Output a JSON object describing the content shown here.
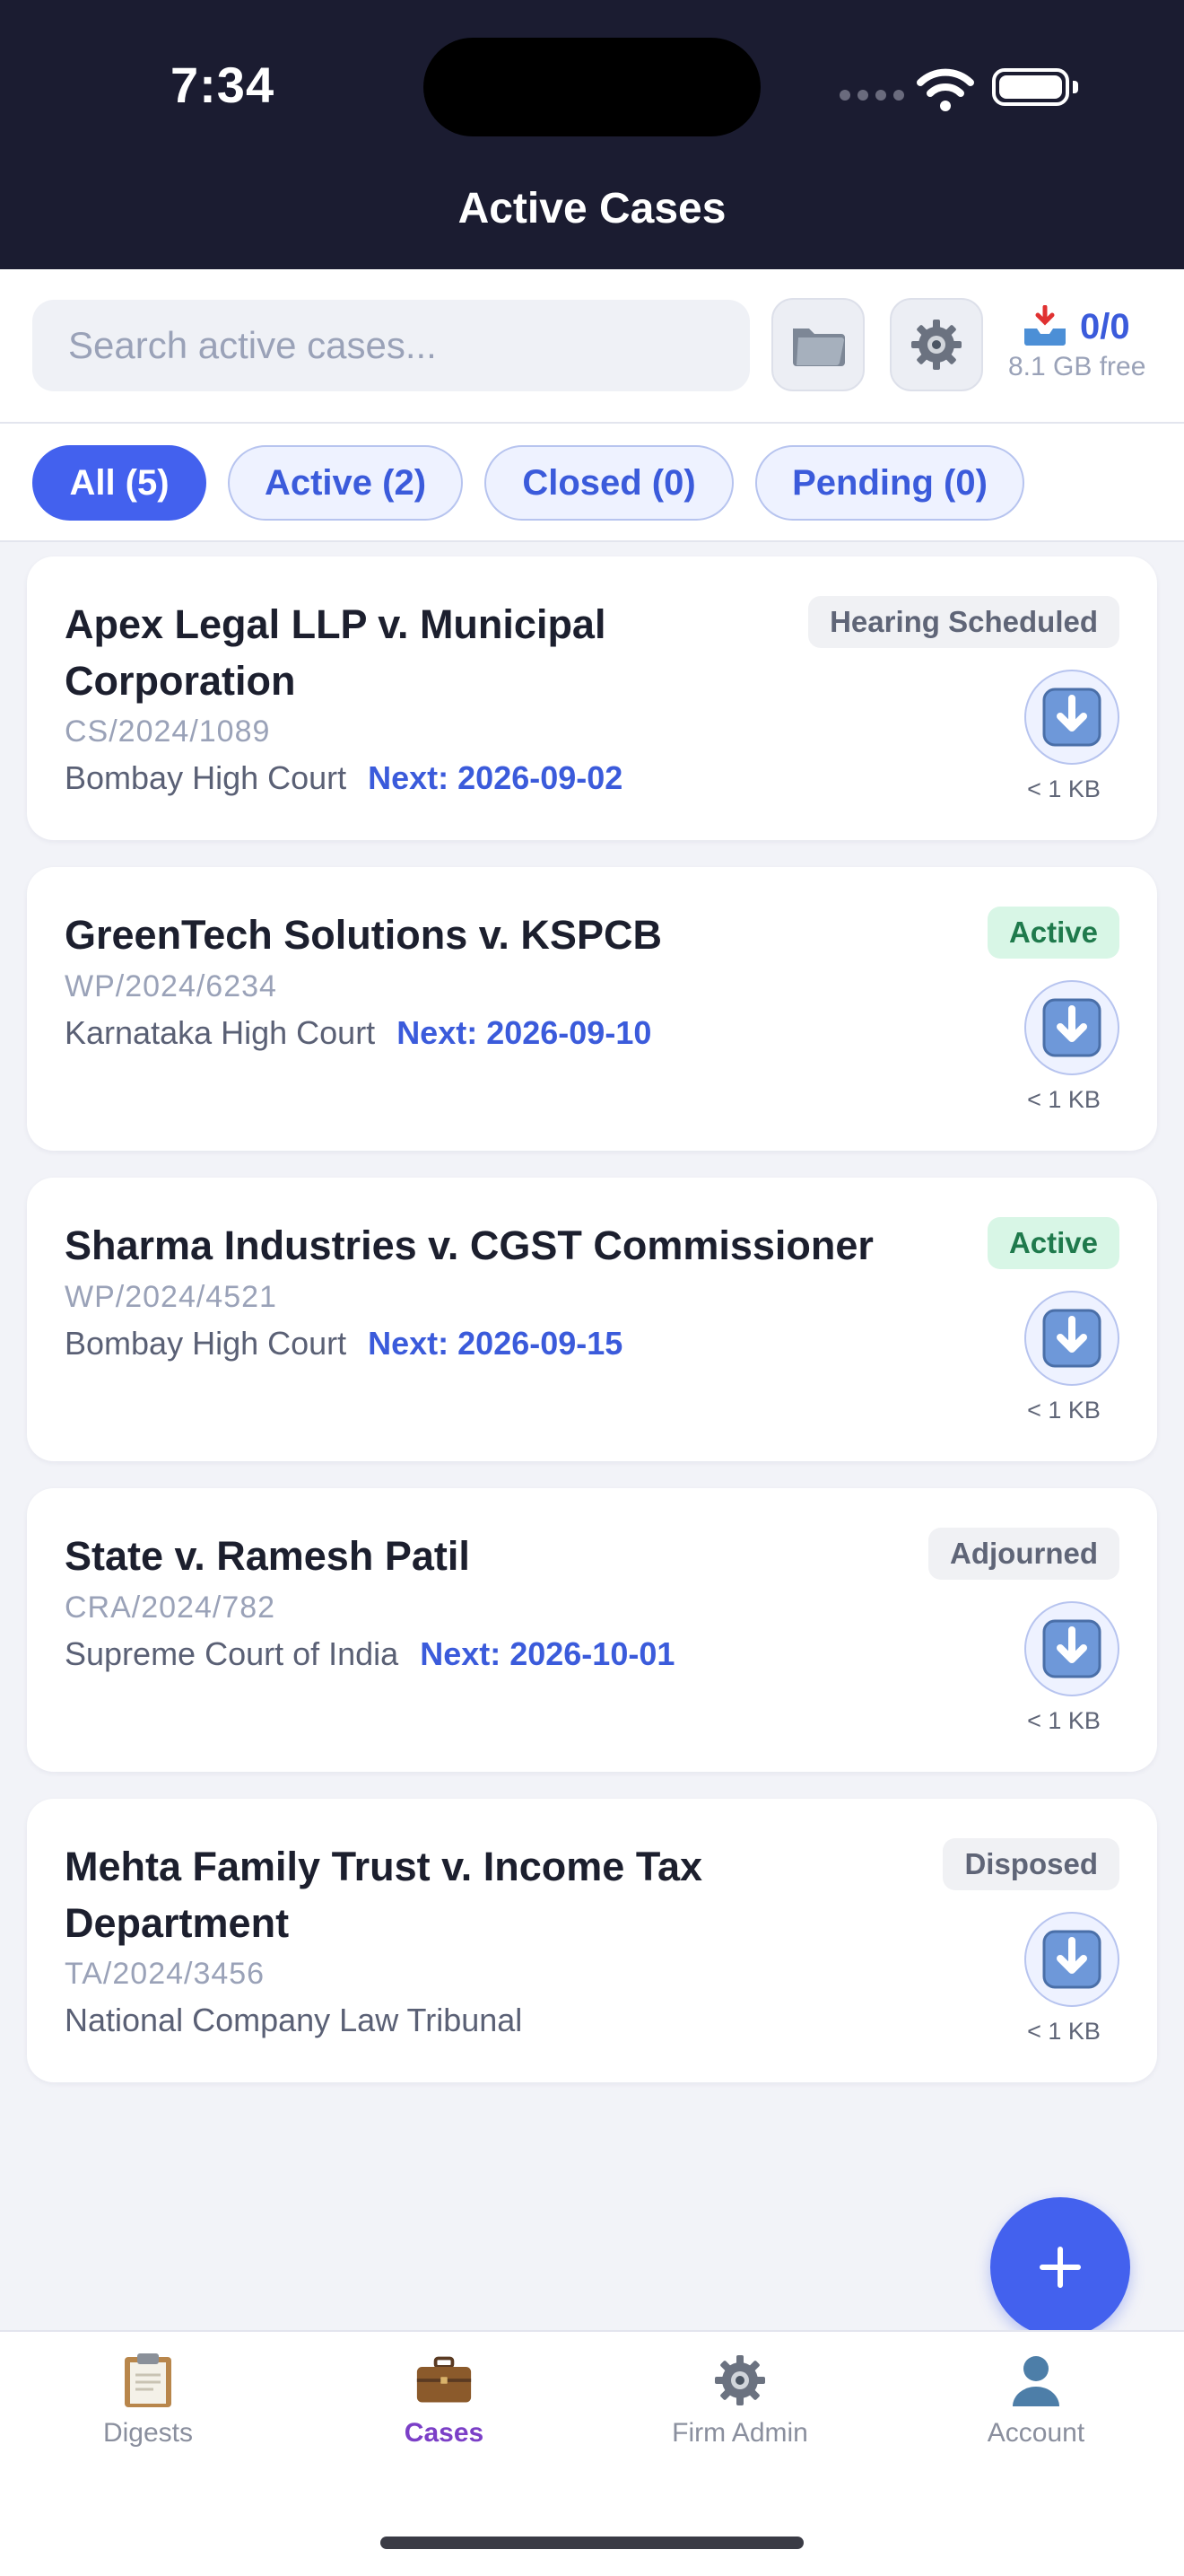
{
  "status_bar": {
    "time": "7:34"
  },
  "header": {
    "title": "Active Cases"
  },
  "toolbar": {
    "search_placeholder": "Search active cases...",
    "folder_icon": "folder-icon",
    "settings_icon": "gear-icon",
    "download_count": "0/0",
    "storage_free": "8.1 GB free"
  },
  "filters": [
    {
      "label": "All (5)",
      "selected": true
    },
    {
      "label": "Active (2)",
      "selected": false
    },
    {
      "label": "Closed (0)",
      "selected": false
    },
    {
      "label": "Pending (0)",
      "selected": false
    }
  ],
  "cases": [
    {
      "title": "Apex Legal LLP v. Municipal Corporation",
      "case_no": "CS/2024/1089",
      "court": "Bombay High Court",
      "next": "Next: 2026-09-02",
      "status": "Hearing Scheduled",
      "size": "< 1 KB"
    },
    {
      "title": "GreenTech Solutions v. KSPCB",
      "case_no": "WP/2024/6234",
      "court": "Karnataka High Court",
      "next": "Next: 2026-09-10",
      "status": "Active",
      "size": "< 1 KB"
    },
    {
      "title": "Sharma Industries v. CGST Commissioner",
      "case_no": "WP/2024/4521",
      "court": "Bombay High Court",
      "next": "Next: 2026-09-15",
      "status": "Active",
      "size": "< 1 KB"
    },
    {
      "title": "State v. Ramesh Patil",
      "case_no": "CRA/2024/782",
      "court": "Supreme Court of India",
      "next": "Next: 2026-10-01",
      "status": "Adjourned",
      "size": "< 1 KB"
    },
    {
      "title": "Mehta Family Trust v. Income Tax Department",
      "case_no": "TA/2024/3456",
      "court": "National Company Law Tribunal",
      "next": "",
      "status": "Disposed",
      "size": "< 1 KB"
    }
  ],
  "colors": {
    "accent": "#4361ee",
    "header_bg": "#1b1c31",
    "active_badge_bg": "#d8f6e6",
    "active_badge_text": "#1f7a4c"
  },
  "tabs": [
    {
      "label": "Digests",
      "icon": "clipboard-icon"
    },
    {
      "label": "Cases",
      "icon": "briefcase-icon",
      "selected": true
    },
    {
      "label": "Firm Admin",
      "icon": "gear-icon"
    },
    {
      "label": "Account",
      "icon": "user-icon"
    }
  ]
}
